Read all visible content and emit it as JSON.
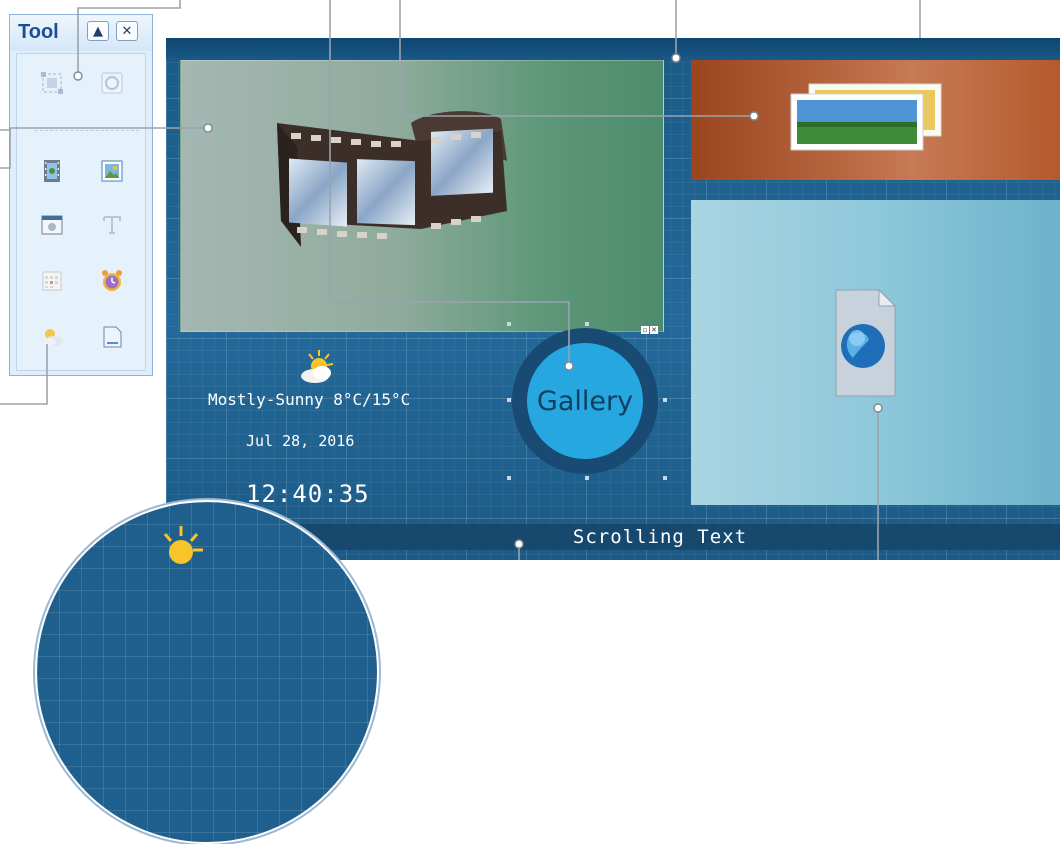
{
  "tool_panel": {
    "title": "Tool",
    "collapse_symbol": "▲",
    "close_symbol": "✕",
    "tools": [
      {
        "name": "select-region-icon",
        "state": "disabled"
      },
      {
        "name": "record-icon",
        "state": "disabled"
      },
      {
        "name": "video-tool-icon",
        "state": "enabled"
      },
      {
        "name": "image-tool-icon",
        "state": "enabled"
      },
      {
        "name": "webpage-tool-icon",
        "state": "enabled"
      },
      {
        "name": "text-tool-icon",
        "state": "disabled"
      },
      {
        "name": "calendar-tool-icon",
        "state": "disabled"
      },
      {
        "name": "clock-tool-icon",
        "state": "enabled"
      },
      {
        "name": "weather-tool-icon",
        "state": "enabled"
      },
      {
        "name": "document-tool-icon",
        "state": "enabled"
      }
    ]
  },
  "canvas": {
    "weather": "Mostly-Sunny 8°C/15°C",
    "date": "Jul 28, 2016",
    "clock": "12:40:35",
    "gallery_label": "Gallery",
    "scrolling_text": "Scrolling Text"
  },
  "colors": {
    "canvas_bg": "#1d5b86",
    "gallery_ring": "#184a73",
    "gallery_fill": "#27a7df",
    "panel_title": "#1b4f93"
  }
}
